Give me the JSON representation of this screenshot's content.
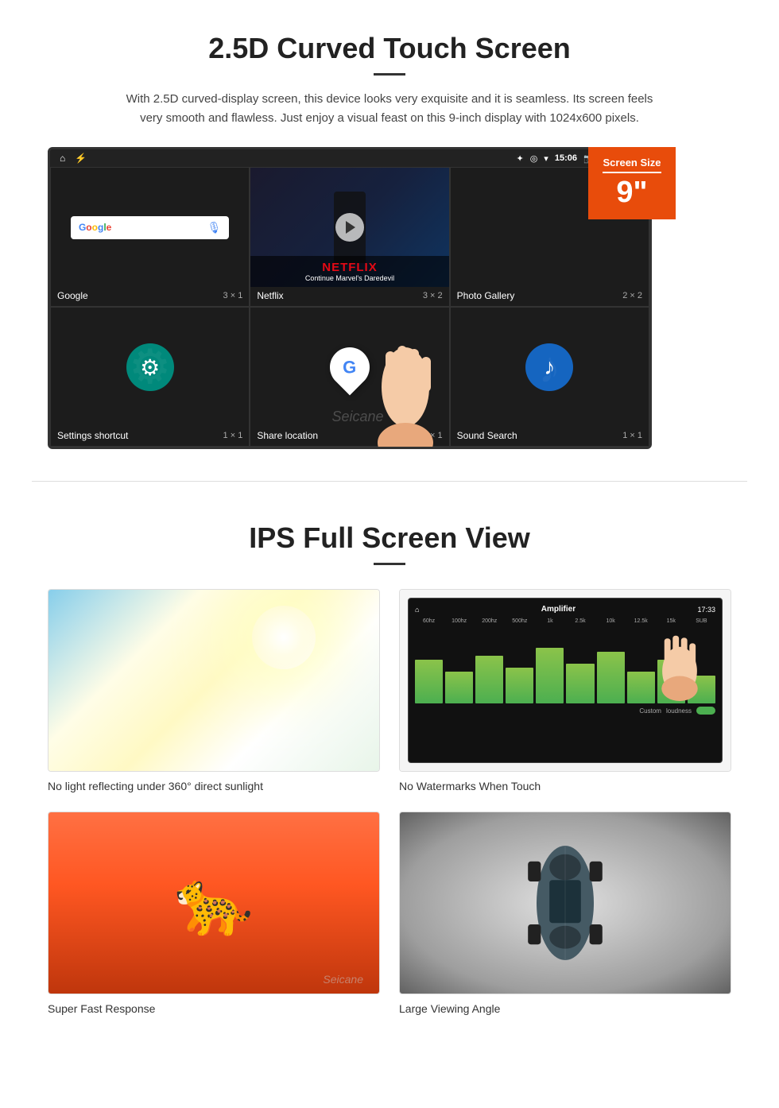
{
  "section1": {
    "title": "2.5D Curved Touch Screen",
    "description": "With 2.5D curved-display screen, this device looks very exquisite and it is seamless. Its screen feels very smooth and flawless. Just enjoy a visual feast on this 9-inch display with 1024x600 pixels.",
    "badge": {
      "label": "Screen Size",
      "size": "9\""
    },
    "statusBar": {
      "time": "15:06"
    },
    "apps": [
      {
        "name": "Google",
        "size": "3 × 1"
      },
      {
        "name": "Netflix",
        "size": "3 × 2"
      },
      {
        "name": "Photo Gallery",
        "size": "2 × 2"
      },
      {
        "name": "Settings shortcut",
        "size": "1 × 1"
      },
      {
        "name": "Share location",
        "size": "1 × 1"
      },
      {
        "name": "Sound Search",
        "size": "1 × 1"
      }
    ],
    "netflix": {
      "logo": "NETFLIX",
      "subtitle": "Continue Marvel's Daredevil"
    },
    "watermark": "Seicane"
  },
  "section2": {
    "title": "IPS Full Screen View",
    "features": [
      {
        "id": "sunlight",
        "caption": "No light reflecting under 360° direct sunlight"
      },
      {
        "id": "amplifier",
        "caption": "No Watermarks When Touch"
      },
      {
        "id": "cheetah",
        "caption": "Super Fast Response"
      },
      {
        "id": "car",
        "caption": "Large Viewing Angle"
      }
    ],
    "watermark": "Seicane"
  }
}
